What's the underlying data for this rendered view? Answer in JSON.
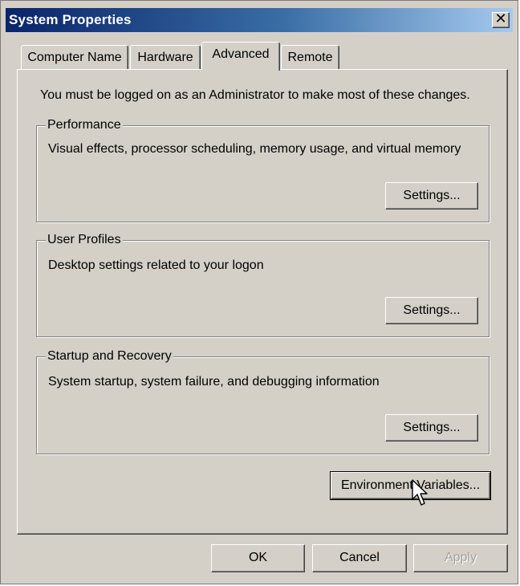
{
  "window": {
    "title": "System Properties",
    "close_glyph": "✕",
    "close_icon": "close-icon"
  },
  "tabs": [
    {
      "label": "Computer Name",
      "active": false
    },
    {
      "label": "Hardware",
      "active": false
    },
    {
      "label": "Advanced",
      "active": true
    },
    {
      "label": "Remote",
      "active": false
    }
  ],
  "advanced": {
    "admin_note": "You must be logged on as an Administrator to make most of these changes.",
    "performance": {
      "legend": "Performance",
      "description": "Visual effects, processor scheduling, memory usage, and virtual memory",
      "settings_label": "Settings..."
    },
    "user_profiles": {
      "legend": "User Profiles",
      "description": "Desktop settings related to your logon",
      "settings_label": "Settings..."
    },
    "startup_recovery": {
      "legend": "Startup and Recovery",
      "description": "System startup, system failure, and debugging information",
      "settings_label": "Settings..."
    },
    "env_vars_label": "Environment Variables..."
  },
  "footer": {
    "ok_label": "OK",
    "cancel_label": "Cancel",
    "apply_label": "Apply",
    "apply_enabled": false
  },
  "pointer": {
    "icon": "arrow-cursor-icon"
  },
  "colors": {
    "title_gradient_start": "#0a246a",
    "title_gradient_end": "#a6caf0",
    "window_face": "#d4d0c8"
  }
}
